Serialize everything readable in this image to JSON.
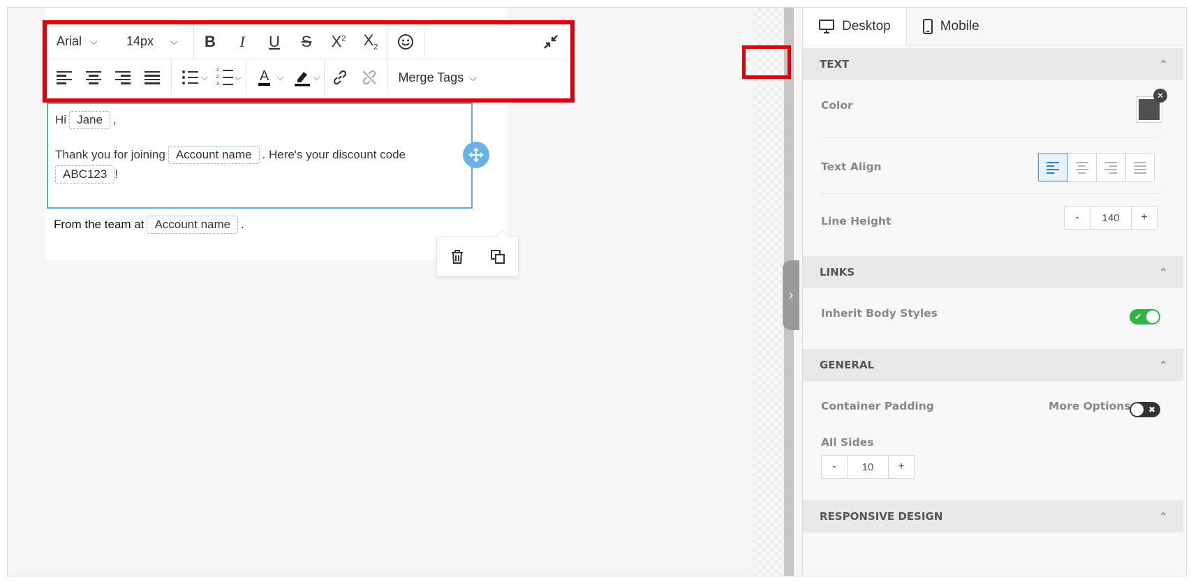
{
  "toolbar": {
    "font_family": "Arial",
    "font_size": "14px",
    "merge_tags_label": "Merge Tags"
  },
  "editor": {
    "greeting_prefix": "Hi",
    "first_name_tag": "Jane",
    "greeting_suffix": ",",
    "thanks_prefix": "Thank you for joining",
    "account_tag": "Account name",
    "thanks_suffix": ". Here's your discount code",
    "code_tag": "ABC123",
    "code_suffix": "!",
    "footer_prefix": "From the team at",
    "footer_account_tag": "Account name",
    "footer_suffix": "."
  },
  "panel": {
    "tabs": [
      {
        "label": "Desktop",
        "icon": "desktop-icon",
        "active": true
      },
      {
        "label": "Mobile",
        "icon": "mobile-icon",
        "active": false
      }
    ],
    "text_section": {
      "title": "TEXT",
      "color_label": "Color",
      "color_value": "#505050",
      "align_label": "Text Align",
      "line_height_label": "Line Height",
      "line_height_value": "140",
      "minus": "-",
      "plus": "+"
    },
    "links_section": {
      "title": "LINKS",
      "inherit_label": "Inherit Body Styles",
      "inherit_on": true
    },
    "general_section": {
      "title": "GENERAL",
      "padding_label": "Container Padding",
      "more_options_label": "More Options",
      "more_options_on": false,
      "all_sides_label": "All Sides",
      "all_sides_value": "10",
      "minus": "-",
      "plus": "+"
    },
    "responsive_section": {
      "title": "RESPONSIVE DESIGN"
    }
  },
  "colors": {
    "highlight": "#e00010",
    "selection": "#5aace4",
    "toggle_on": "#2fb344",
    "toggle_off": "#333333"
  }
}
